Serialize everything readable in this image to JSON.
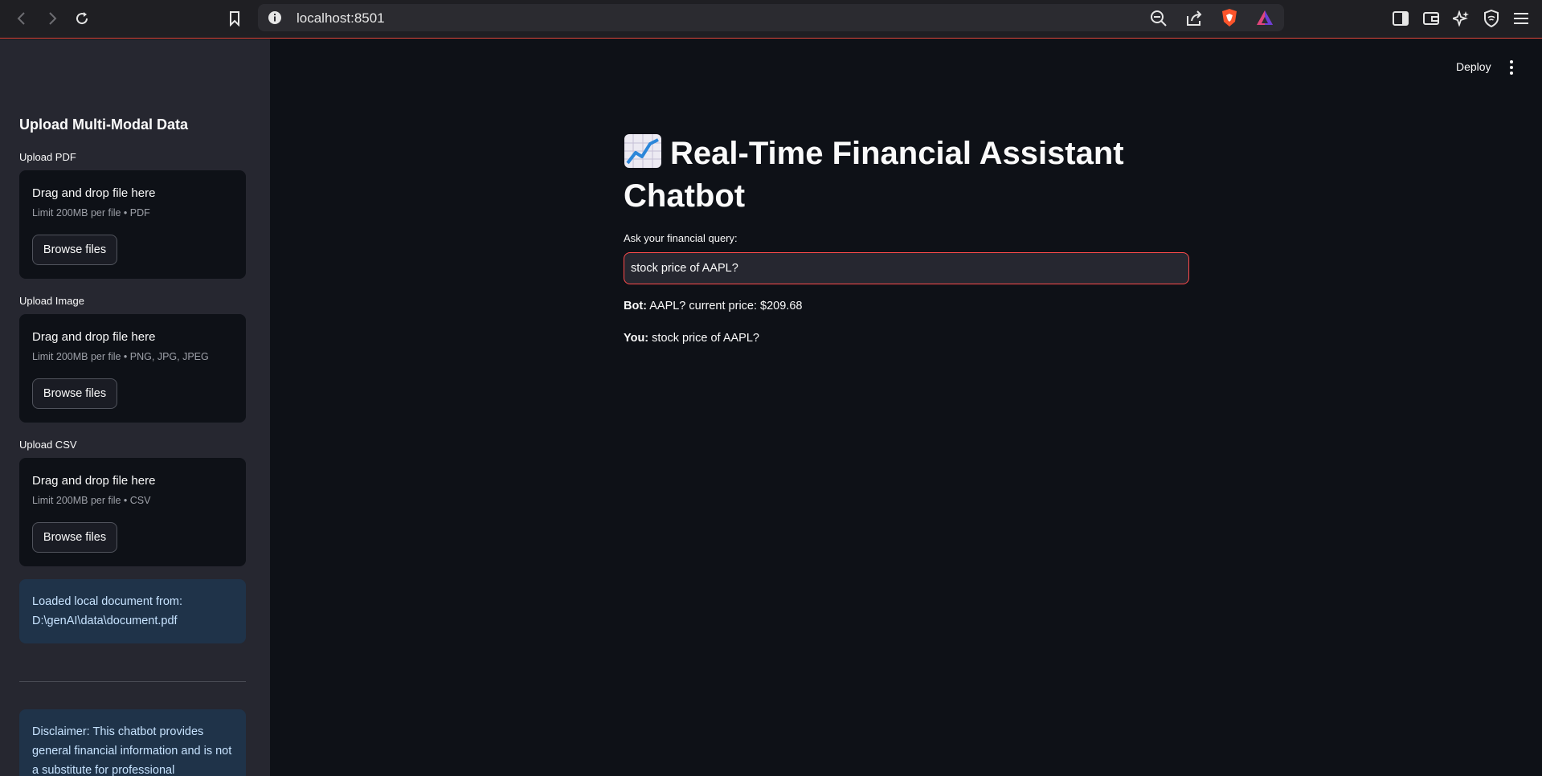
{
  "browser": {
    "url": "localhost:8501"
  },
  "sidebar": {
    "heading": "Upload Multi-Modal Data",
    "uploaders": [
      {
        "label": "Upload PDF",
        "drop_text": "Drag and drop file here",
        "limit": "Limit 200MB per file • PDF",
        "button": "Browse files"
      },
      {
        "label": "Upload Image",
        "drop_text": "Drag and drop file here",
        "limit": "Limit 200MB per file • PNG, JPG, JPEG",
        "button": "Browse files"
      },
      {
        "label": "Upload CSV",
        "drop_text": "Drag and drop file here",
        "limit": "Limit 200MB per file • CSV",
        "button": "Browse files"
      }
    ],
    "loaded_info": "Loaded local document from: D:\\genAI\\data\\document.pdf",
    "disclaimer": "Disclaimer: This chatbot provides general financial information and is not a substitute for professional"
  },
  "header": {
    "deploy_label": "Deploy"
  },
  "main": {
    "title": "Real-Time Financial Assistant Chatbot",
    "query_label": "Ask your financial query:",
    "query_value": "stock price of AAPL?",
    "messages": [
      {
        "speaker": "Bot:",
        "text": " AAPL? current price: $209.68"
      },
      {
        "speaker": "You:",
        "text": " stock price of AAPL?"
      }
    ]
  },
  "colors": {
    "accent": "#ff4b4b",
    "background": "#0e1117",
    "sidebar": "#262730",
    "info_box": "#1f3349"
  },
  "icons": [
    "back-icon",
    "forward-icon",
    "reload-icon",
    "bookmark-icon",
    "site-info-icon",
    "zoom-out-icon",
    "share-icon",
    "brave-shield-icon",
    "brave-rewards-icon",
    "sidebar-toggle-icon",
    "wallet-icon",
    "leo-ai-icon",
    "vpn-icon",
    "menu-icon",
    "chart-emoji-icon",
    "kebab-menu-icon"
  ]
}
